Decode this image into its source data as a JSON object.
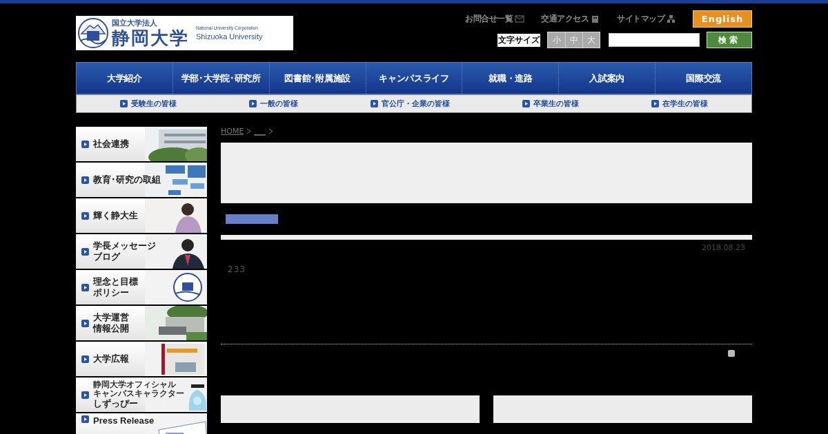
{
  "header": {
    "logo": {
      "kicker": "国立大学法人",
      "name": "静岡大学",
      "english_line_1": "National University Corporation",
      "english_line_2": "Shizuoka University"
    },
    "utility_links": [
      {
        "label": "お問合せ一覧",
        "kind": "mail"
      },
      {
        "label": "交通アクセス",
        "kind": "building"
      },
      {
        "label": "サイトマップ",
        "kind": "sitemap"
      }
    ],
    "english_button": "English",
    "font_size": {
      "label": "文字サイズ",
      "options": [
        "小",
        "中",
        "大"
      ]
    },
    "search_button": "検索"
  },
  "main_nav": [
    "大学紹介",
    "学部･大学院･研究所",
    "図書館･附属施設",
    "キャンパスライフ",
    "就職・進路",
    "入試案内",
    "国際交流"
  ],
  "audience_nav": [
    "受験生の皆様",
    "一般の皆様",
    "官公庁・企業の皆様",
    "卒業生の皆様",
    "在学生の皆様"
  ],
  "sidebar_banners": [
    {
      "lines": [
        {
          "text": "社会連携",
          "kind": "title"
        }
      ]
    },
    {
      "lines": [
        {
          "text": "教育･研究の取組",
          "kind": "title"
        }
      ]
    },
    {
      "lines": [
        {
          "text": "輝く静大生",
          "kind": "title"
        }
      ]
    },
    {
      "lines": [
        {
          "text": "学長メッセージ",
          "kind": "title"
        },
        {
          "text": "ブログ",
          "kind": "title"
        }
      ]
    },
    {
      "lines": [
        {
          "text": "理念と目標",
          "kind": "title"
        },
        {
          "text": "ポリシー",
          "kind": "title"
        }
      ]
    },
    {
      "lines": [
        {
          "text": "大学運営",
          "kind": "title"
        },
        {
          "text": "情報公開",
          "kind": "title"
        }
      ]
    },
    {
      "lines": [
        {
          "text": "大学広報",
          "kind": "title"
        }
      ]
    },
    {
      "lines": [
        {
          "text": "静岡大学オフィシャル",
          "kind": "caption"
        },
        {
          "text": "キャンパスキャラクター",
          "kind": "caption"
        },
        {
          "text": "しずっぴー",
          "kind": "title"
        }
      ]
    },
    {
      "lines": [
        {
          "text": "Press Release",
          "kind": "latin"
        }
      ]
    }
  ],
  "breadcrumb": [
    "HOME",
    "___"
  ],
  "article": {
    "date": "2018.08.23",
    "body": "233"
  }
}
